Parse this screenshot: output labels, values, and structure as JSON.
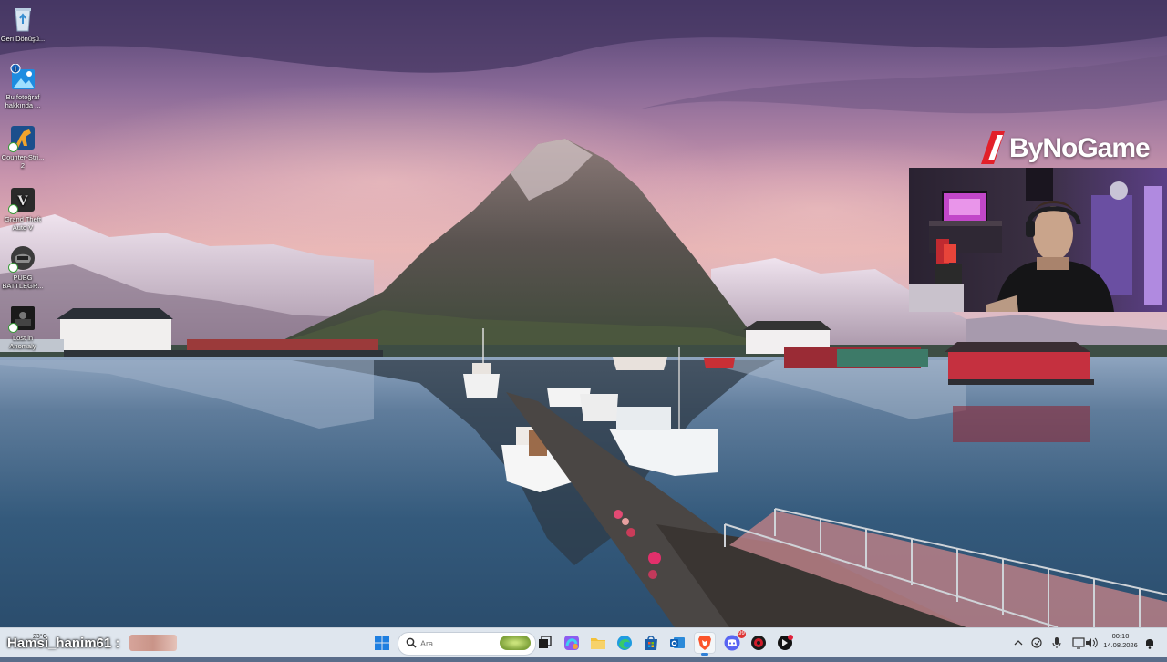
{
  "desktop": {
    "icons": [
      {
        "name": "recycle-bin",
        "label": "Geri Dönüşü..."
      },
      {
        "name": "about-photo",
        "label": "Bu fotoğraf hakkında ..."
      },
      {
        "name": "counter-strike",
        "label": "Counter-Stri... 2"
      },
      {
        "name": "gta-v",
        "label": "Grand Theft Auto V"
      },
      {
        "name": "pubg",
        "label": "PUBG BATTLEGR..."
      },
      {
        "name": "lost-in-anomaly",
        "label": "Lost in Anomaly"
      }
    ]
  },
  "overlay": {
    "brand": "ByNoGame"
  },
  "taskbar": {
    "weather": "23°C",
    "overlay_name": "Hamsi_hanim61 :",
    "search_placeholder": "Ara",
    "apps": [
      {
        "name": "start-button"
      },
      {
        "name": "task-view"
      },
      {
        "name": "copilot"
      },
      {
        "name": "file-explorer"
      },
      {
        "name": "edge"
      },
      {
        "name": "microsoft-store"
      },
      {
        "name": "outlook"
      },
      {
        "name": "brave"
      },
      {
        "name": "discord",
        "badge": "99"
      },
      {
        "name": "app-red"
      },
      {
        "name": "app-dark"
      }
    ],
    "clock_time": "00:10",
    "clock_date": "14.08.2026"
  },
  "colors": {
    "sky_top": "#5e4a7c",
    "sky_mid": "#c98aa6",
    "water": "#3b5f7e",
    "taskbar": "#dfe6ee",
    "accent": "#2f7fd6"
  }
}
